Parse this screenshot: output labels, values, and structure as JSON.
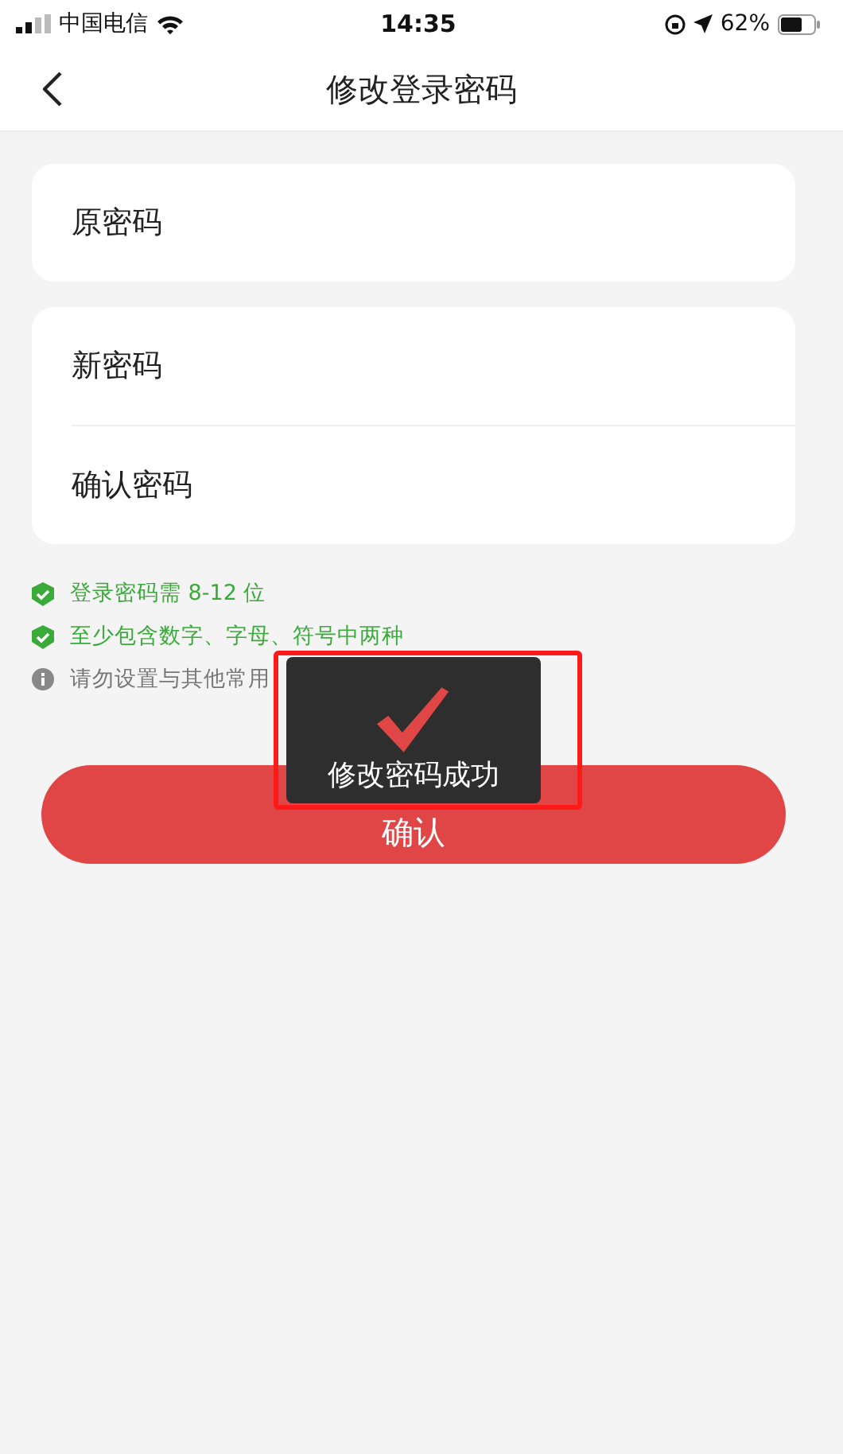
{
  "status_bar": {
    "carrier": "中国电信",
    "time": "14:35",
    "battery": "62%"
  },
  "nav": {
    "title": "修改登录密码"
  },
  "groups": [
    {
      "fields": [
        {
          "label": "原密码"
        }
      ]
    },
    {
      "fields": [
        {
          "label": "新密码"
        },
        {
          "label": "确认密码"
        }
      ]
    }
  ],
  "hints": [
    {
      "kind": "ok",
      "text": "登录密码需 8-12 位"
    },
    {
      "kind": "ok",
      "text": "至少包含数字、字母、符号中两种"
    },
    {
      "kind": "info",
      "text": "请勿设置与其他常用"
    }
  ],
  "confirm_button": "确认",
  "toast": {
    "text": "修改密码成功"
  }
}
